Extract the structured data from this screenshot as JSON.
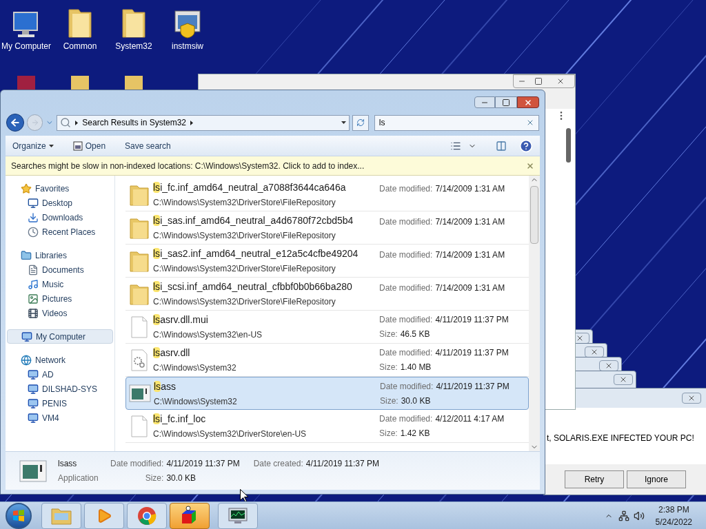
{
  "desktop_icons": [
    {
      "label": "My Computer",
      "kind": "computer"
    },
    {
      "label": "Common",
      "kind": "folder"
    },
    {
      "label": "System32",
      "kind": "folder"
    },
    {
      "label": "instmsiw",
      "kind": "installer"
    }
  ],
  "error_dialog": {
    "message": "t, SOLARIS.EXE INFECTED YOUR PC!",
    "buttons": [
      "Retry",
      "Ignore"
    ]
  },
  "explorer": {
    "address": "Search Results in System32",
    "search": "ls",
    "toolbar": [
      {
        "label": "Organize",
        "kind": "menu"
      },
      {
        "label": "Open",
        "kind": "open"
      },
      {
        "label": "Save search",
        "kind": "plain"
      }
    ],
    "infobar": "Searches might be slow in non-indexed locations: C:\\Windows\\System32. Click to add to index...",
    "nav": [
      {
        "label": "Favorites",
        "kind": "star",
        "selected": false,
        "children": [
          {
            "label": "Desktop",
            "kind": "desktop",
            "selected": false
          },
          {
            "label": "Downloads",
            "kind": "downloads",
            "selected": false
          },
          {
            "label": "Recent Places",
            "kind": "recent",
            "selected": false
          }
        ]
      },
      {
        "label": "Libraries",
        "kind": "library",
        "selected": false,
        "children": [
          {
            "label": "Documents",
            "kind": "documents",
            "selected": false
          },
          {
            "label": "Music",
            "kind": "music",
            "selected": false
          },
          {
            "label": "Pictures",
            "kind": "pictures",
            "selected": false
          },
          {
            "label": "Videos",
            "kind": "videos",
            "selected": false
          }
        ]
      },
      {
        "label": "My Computer",
        "kind": "computer",
        "selected": true
      },
      {
        "label": "Network",
        "kind": "network",
        "selected": false,
        "children": [
          {
            "label": "AD",
            "kind": "computer",
            "selected": false
          },
          {
            "label": "DILSHAD-SYS",
            "kind": "computer",
            "selected": false
          },
          {
            "label": "PENIS",
            "kind": "computer",
            "selected": false
          },
          {
            "label": "VM4",
            "kind": "computer",
            "selected": false
          }
        ]
      }
    ],
    "results": [
      {
        "kind": "folder",
        "match": "ls",
        "name_rest": "i_fc.inf_amd64_neutral_a7088f3644ca646a",
        "path": "C:\\Windows\\System32\\DriverStore\\FileRepository",
        "date_label": "Date modified:",
        "date": "7/14/2009 1:31 AM",
        "selected": false
      },
      {
        "kind": "folder",
        "match": "ls",
        "name_rest": "i_sas.inf_amd64_neutral_a4d6780f72cbd5b4",
        "path": "C:\\Windows\\System32\\DriverStore\\FileRepository",
        "date_label": "Date modified:",
        "date": "7/14/2009 1:31 AM",
        "selected": false
      },
      {
        "kind": "folder",
        "match": "ls",
        "name_rest": "i_sas2.inf_amd64_neutral_e12a5c4cfbe49204",
        "path": "C:\\Windows\\System32\\DriverStore\\FileRepository",
        "date_label": "Date modified:",
        "date": "7/14/2009 1:31 AM",
        "selected": false
      },
      {
        "kind": "folder",
        "match": "ls",
        "name_rest": "i_scsi.inf_amd64_neutral_cfbbf0b0b66ba280",
        "path": "C:\\Windows\\System32\\DriverStore\\FileRepository",
        "date_label": "Date modified:",
        "date": "7/14/2009 1:31 AM",
        "selected": false
      },
      {
        "kind": "file",
        "match": "ls",
        "name_rest": "asrv.dll.mui",
        "path": "C:\\Windows\\System32\\en-US",
        "date_label": "Date modified:",
        "date": "4/11/2019 11:37 PM",
        "size_label": "Size:",
        "size": "46.5 KB",
        "selected": false
      },
      {
        "kind": "dll",
        "match": "ls",
        "name_rest": "asrv.dll",
        "path": "C:\\Windows\\System32",
        "date_label": "Date modified:",
        "date": "4/11/2019 11:37 PM",
        "size_label": "Size:",
        "size": "1.40 MB",
        "selected": false
      },
      {
        "kind": "app",
        "match": "ls",
        "name_rest": "ass",
        "path": "C:\\Windows\\System32",
        "date_label": "Date modified:",
        "date": "4/11/2019 11:37 PM",
        "size_label": "Size:",
        "size": "30.0 KB",
        "selected": true
      },
      {
        "kind": "file",
        "match": "ls",
        "name_rest": "i_fc.inf_loc",
        "path": "C:\\Windows\\System32\\DriverStore\\en-US",
        "date_label": "Date modified:",
        "date": "4/12/2011 4:17 AM",
        "size_label": "Size:",
        "size": "1.42 KB",
        "selected": false
      }
    ],
    "details": {
      "name": "lsass",
      "type": "Application",
      "modified_label": "Date modified:",
      "modified": "4/11/2019 11:37 PM",
      "created_label": "Date created:",
      "created": "4/11/2019 11:37 PM",
      "size_label": "Size:",
      "size": "30.0 KB"
    }
  },
  "taskbar": {
    "apps": [
      {
        "kind": "explorer",
        "selected": false
      },
      {
        "kind": "media",
        "selected": false
      },
      {
        "kind": "browser",
        "selected": false
      },
      {
        "kind": "paint3d",
        "selected": true
      },
      {
        "kind": "taskmgr",
        "selected": false
      }
    ],
    "time": "2:38 PM",
    "date": "5/24/2022"
  }
}
